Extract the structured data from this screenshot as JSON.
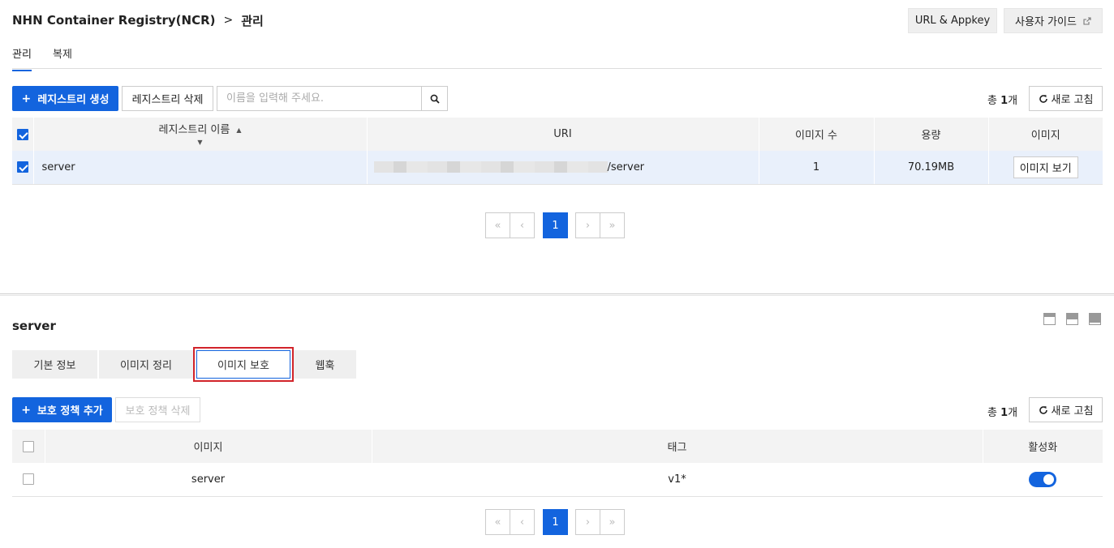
{
  "header": {
    "service": "NHN Container Registry(NCR)",
    "separator": ">",
    "page": "관리",
    "url_appkey_label": "URL & Appkey",
    "guide_label": "사용자 가이드"
  },
  "top_tabs": [
    {
      "label": "관리",
      "active": true
    },
    {
      "label": "복제",
      "active": false
    }
  ],
  "registry_toolbar": {
    "create_label": "레지스트리 생성",
    "delete_label": "레지스트리 삭제",
    "search_placeholder": "이름을 입력해 주세요.",
    "total_prefix": "총 ",
    "total_count": "1",
    "total_suffix": "개",
    "refresh_label": "새로 고침"
  },
  "registry_table": {
    "columns": [
      "레지스트리 이름",
      "URI",
      "이미지 수",
      "용량",
      "이미지"
    ],
    "rows": [
      {
        "name": "server",
        "uri_suffix": "/server",
        "image_count": "1",
        "size": "70.19MB",
        "action": "이미지 보기",
        "selected": true
      }
    ]
  },
  "pagination": {
    "first": "«",
    "prev": "‹",
    "current": "1",
    "next": "›",
    "last": "»"
  },
  "detail": {
    "title": "server",
    "tabs": [
      {
        "label": "기본 정보",
        "active": false
      },
      {
        "label": "이미지 정리",
        "active": false
      },
      {
        "label": "이미지 보호",
        "active": true
      },
      {
        "label": "웹훅",
        "active": false
      }
    ]
  },
  "protection_toolbar": {
    "add_label": "보호 정책 추가",
    "delete_label": "보호 정책 삭제",
    "total_prefix": "총 ",
    "total_count": "1",
    "total_suffix": "개",
    "refresh_label": "새로 고침"
  },
  "protection_table": {
    "columns": [
      "이미지",
      "태그",
      "활성화"
    ],
    "rows": [
      {
        "image": "server",
        "tag": "v1*",
        "enabled": true
      }
    ]
  },
  "colors": {
    "primary": "#1364de",
    "highlight_border": "#d2242a",
    "selected_row": "#e9f0fb"
  }
}
